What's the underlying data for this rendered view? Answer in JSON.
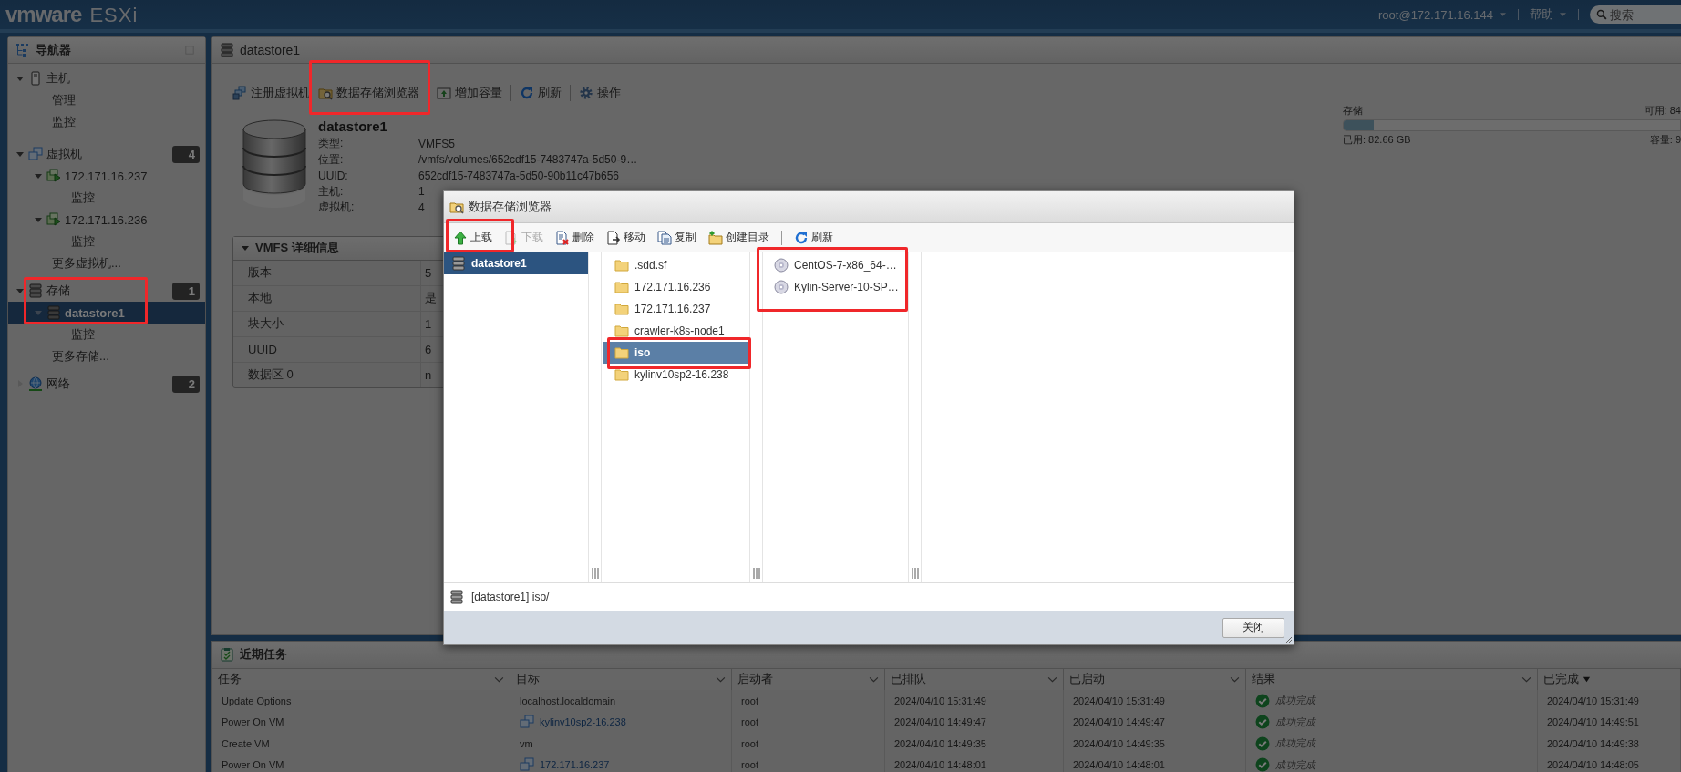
{
  "header": {
    "logo": "vmware",
    "product": "ESXi",
    "user": "root@172.171.16.144",
    "help": "帮助",
    "search": {
      "placeholder": "搜索"
    }
  },
  "navigator": {
    "title": "导航器",
    "sections": [
      {
        "label": "主机",
        "kind": "host",
        "expanded": true,
        "selected": false,
        "children": [
          {
            "label": "管理",
            "kind": "link",
            "selected": false
          },
          {
            "label": "监控",
            "kind": "link",
            "selected": false
          }
        ]
      },
      {
        "label": "虚拟机",
        "kind": "vms",
        "count": "4",
        "expanded": true,
        "selected": false,
        "children": [
          {
            "label": "172.171.16.237",
            "kind": "vm",
            "expanded": true,
            "selected": false,
            "children": [
              {
                "label": "监控",
                "kind": "link",
                "selected": false
              }
            ]
          },
          {
            "label": "172.171.16.236",
            "kind": "vm",
            "expanded": true,
            "selected": false,
            "children": [
              {
                "label": "监控",
                "kind": "link",
                "selected": false
              }
            ]
          },
          {
            "label": "更多虚拟机...",
            "kind": "link",
            "selected": false
          }
        ]
      },
      {
        "label": "存储",
        "kind": "storage",
        "count": "1",
        "expanded": true,
        "selected": false,
        "annotated": true,
        "children": [
          {
            "label": "datastore1",
            "kind": "datastore",
            "expanded": true,
            "selected": true,
            "children": [
              {
                "label": "监控",
                "kind": "link",
                "selected": false
              }
            ]
          },
          {
            "label": "更多存储...",
            "kind": "link",
            "selected": false
          }
        ]
      },
      {
        "label": "网络",
        "kind": "network",
        "count": "2",
        "expanded": false,
        "selected": false
      }
    ]
  },
  "main": {
    "title": "datastore1",
    "toolbar": [
      {
        "label": "注册虚拟机"
      },
      {
        "label": "数据存储浏览器",
        "annotated": true
      },
      {
        "label": "增加容量"
      },
      {
        "label": "刷新"
      },
      {
        "label": "操作"
      }
    ],
    "summary": {
      "name": "datastore1",
      "fields": [
        {
          "label": "类型:",
          "value": "VMFS5"
        },
        {
          "label": "位置:",
          "value": "/vmfs/volumes/652cdf15-7483747a-5d50-9…"
        },
        {
          "label": "UUID:",
          "value": "652cdf15-7483747a-5d50-90b11c47b656"
        },
        {
          "label": "主机:",
          "value": "1"
        },
        {
          "label": "虚拟机:",
          "value": "4"
        }
      ]
    },
    "storage": {
      "label": "存储",
      "available": "可用: 84",
      "used": "已用: 82.66 GB",
      "capacity": "容量: 9",
      "level": 0.09
    },
    "details": {
      "title": "VMFS 详细信息",
      "expanded": true,
      "rows": [
        {
          "label": "版本",
          "value": "5"
        },
        {
          "label": "本地",
          "value": "是"
        },
        {
          "label": "块大小",
          "value": "1"
        },
        {
          "label": "UUID",
          "value": "6"
        },
        {
          "label": "数据区 0",
          "value": "n"
        }
      ]
    }
  },
  "dialog": {
    "title": "数据存储浏览器",
    "toolbar": [
      {
        "label": "上载",
        "disabled": false,
        "annotated": true
      },
      {
        "label": "下载",
        "disabled": true
      },
      {
        "label": "删除",
        "disabled": false
      },
      {
        "label": "移动",
        "disabled": false
      },
      {
        "label": "复制",
        "disabled": false
      },
      {
        "label": "创建目录",
        "disabled": false
      },
      {
        "label": "刷新",
        "disabled": false
      }
    ],
    "datastores": [
      {
        "label": "datastore1",
        "selected": true
      }
    ],
    "folders": [
      {
        "label": ".sdd.sf",
        "selected": false
      },
      {
        "label": "172.171.16.236",
        "selected": false
      },
      {
        "label": "172.171.16.237",
        "selected": false
      },
      {
        "label": "crawler-k8s-node1",
        "selected": false
      },
      {
        "label": "iso",
        "selected": true,
        "annotated": true
      },
      {
        "label": "kylinv10sp2-16.238",
        "selected": false
      }
    ],
    "files": {
      "annotated": true,
      "items": [
        {
          "label": "CentOS-7-x86_64-…"
        },
        {
          "label": "Kylin-Server-10-SP…"
        }
      ]
    },
    "path": "[datastore1] iso/",
    "close_button": "关闭"
  },
  "tasks": {
    "title": "近期任务",
    "columns": [
      {
        "label": "任务",
        "sorted": false
      },
      {
        "label": "目标",
        "sorted": false
      },
      {
        "label": "启动者",
        "sorted": false
      },
      {
        "label": "已排队",
        "sorted": false
      },
      {
        "label": "已启动",
        "sorted": false
      },
      {
        "label": "结果",
        "sorted": false
      },
      {
        "label": "已完成",
        "sorted": true
      }
    ],
    "rows": [
      {
        "task": "Update Options",
        "target": {
          "text": "localhost.localdomain",
          "kind": "host"
        },
        "initiator": "root",
        "queued": "2024/04/10 15:31:49",
        "started": "2024/04/10 15:31:49",
        "result": {
          "text": "成功完成",
          "kind": "success"
        },
        "completed": "2024/04/10 15:31:49"
      },
      {
        "task": "Power On VM",
        "target": {
          "text": "kylinv10sp2-16.238",
          "kind": "vm"
        },
        "initiator": "root",
        "queued": "2024/04/10 14:49:47",
        "started": "2024/04/10 14:49:47",
        "result": {
          "text": "成功完成",
          "kind": "success"
        },
        "completed": "2024/04/10 14:49:51"
      },
      {
        "task": "Create VM",
        "target": {
          "text": "vm",
          "kind": "host"
        },
        "initiator": "root",
        "queued": "2024/04/10 14:49:35",
        "started": "2024/04/10 14:49:35",
        "result": {
          "text": "成功完成",
          "kind": "success"
        },
        "completed": "2024/04/10 14:49:38"
      },
      {
        "task": "Power On VM",
        "target": {
          "text": "172.171.16.237",
          "kind": "vm"
        },
        "initiator": "root",
        "queued": "2024/04/10 14:48:01",
        "started": "2024/04/10 14:48:01",
        "result": {
          "text": "成功完成",
          "kind": "success"
        },
        "completed": "2024/04/10 14:48:05"
      }
    ]
  }
}
